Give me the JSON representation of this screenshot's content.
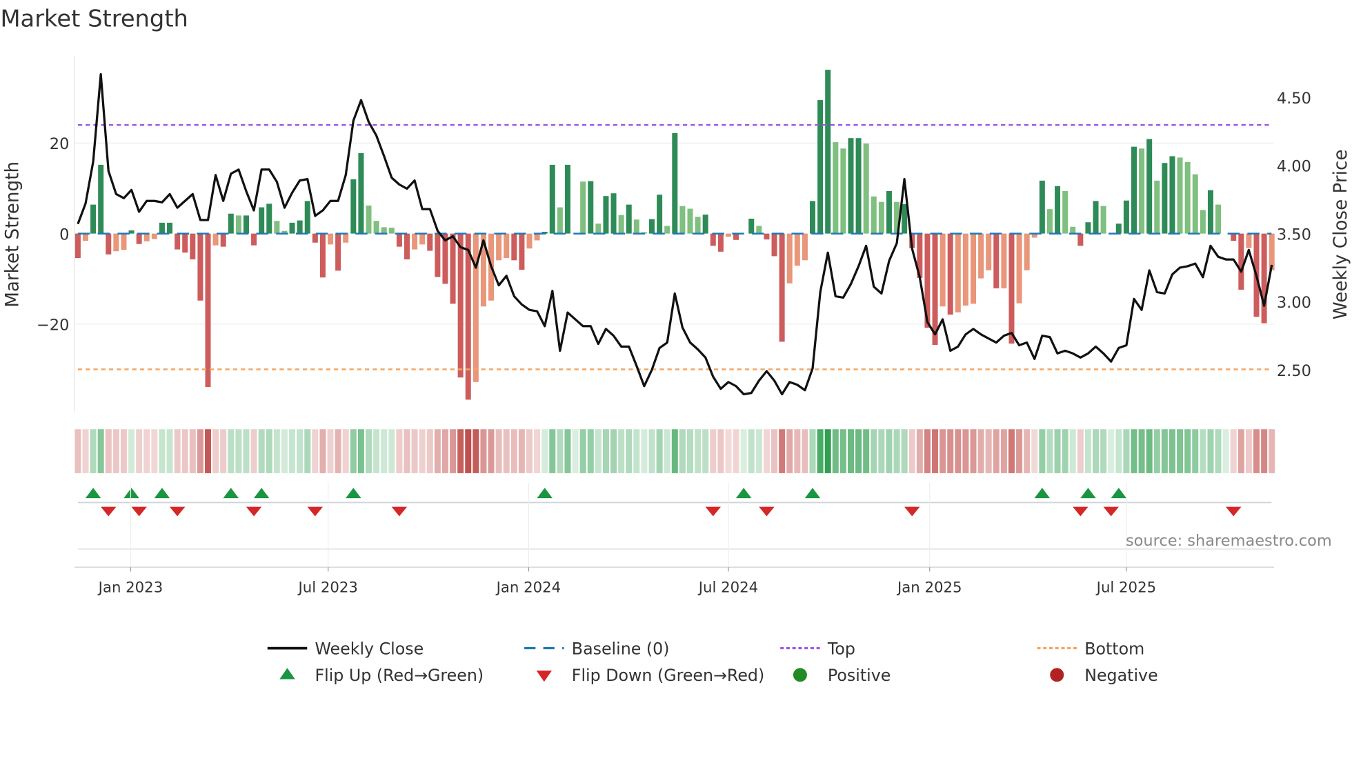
{
  "chart_data": {
    "type": "bar",
    "title": "Market Strength",
    "ylabel": "Market Strength",
    "y2label": "Weekly Close Price",
    "source": "source: sharemaestro.com",
    "ylim": [
      -40,
      40
    ],
    "y2lim": [
      2.2,
      4.8
    ],
    "y_ticks": [
      {
        "v": -20,
        "label": "−20"
      },
      {
        "v": 0,
        "label": "0"
      },
      {
        "v": 20,
        "label": "20"
      }
    ],
    "y2_ticks": [
      {
        "v": 2.5,
        "label": "2.50"
      },
      {
        "v": 3.0,
        "label": "3.00"
      },
      {
        "v": 3.5,
        "label": "3.50"
      },
      {
        "v": 4.0,
        "label": "4.00"
      },
      {
        "v": 4.5,
        "label": "4.50"
      }
    ],
    "x_ticks": [
      {
        "week": 6.9,
        "label": "Jan 2023"
      },
      {
        "week": 32.7,
        "label": "Jul 2023"
      },
      {
        "week": 58.9,
        "label": "Jan 2024"
      },
      {
        "week": 85.0,
        "label": "Jul 2024"
      },
      {
        "week": 111.3,
        "label": "Jan 2025"
      },
      {
        "week": 137.0,
        "label": "Jul 2025"
      }
    ],
    "top_level": 24,
    "bottom_level": -30,
    "baseline": 0,
    "strength": [
      -5.4,
      -1.6,
      6.4,
      15.2,
      -4.6,
      -3.9,
      -3.6,
      0.7,
      -2.3,
      -1.7,
      -1.2,
      2.4,
      2.4,
      -3.5,
      -4.2,
      -5.7,
      -14.8,
      -33.9,
      -2.6,
      -2.9,
      4.4,
      4.0,
      4.0,
      -2.6,
      5.8,
      6.6,
      2.8,
      0.6,
      2.4,
      2.9,
      7.2,
      -2.0,
      -9.7,
      -2.4,
      -8.2,
      -2.0,
      12.0,
      17.8,
      6.2,
      2.8,
      1.4,
      1.3,
      -2.9,
      -5.7,
      -3.5,
      -2.4,
      -3.8,
      -9.6,
      -11.1,
      -15.5,
      -31.8,
      -36.7,
      -32.8,
      -16.1,
      -14.8,
      -5.9,
      -5.4,
      -5.9,
      -8.0,
      -3.3,
      -1.5,
      0.4,
      15.2,
      5.8,
      15.2,
      0,
      11.5,
      11.6,
      2.2,
      8.3,
      8.9,
      4.1,
      6.4,
      3.1,
      0.3,
      3.2,
      8.6,
      1.7,
      22.2,
      6.1,
      5.5,
      3.7,
      4.2,
      -2.7,
      -4.0,
      -0.7,
      -1.4,
      0,
      3.3,
      1.7,
      -1.3,
      -5.0,
      -23.9,
      -11.0,
      -7.1,
      -5.9,
      7.2,
      29.5,
      36.2,
      20.2,
      18.8,
      21.1,
      21.1,
      19.9,
      8.2,
      7.0,
      9.4,
      7.0,
      6.5,
      -3.2,
      -9.8,
      -20.8,
      -24.6,
      -16.1,
      -17.9,
      -17.4,
      -15.9,
      -15.5,
      -9.9,
      -8.1,
      -12.1,
      -12.1,
      -24.3,
      -15.4,
      -8.1,
      -0.9,
      11.7,
      5.4,
      10.5,
      9.4,
      1.5,
      -2.7,
      2.5,
      7.2,
      6.1,
      0,
      2.2,
      7.3,
      19.2,
      18.8,
      20.9,
      11.7,
      15.6,
      17.1,
      16.8,
      15.8,
      13.1,
      5.2,
      9.6,
      6.4,
      0,
      -1.6,
      -12.4,
      -3.2,
      -18.4,
      -19.8,
      -8.1
    ],
    "strong": [
      1,
      0,
      1,
      1,
      1,
      0,
      0,
      1,
      1,
      0,
      0,
      1,
      1,
      1,
      1,
      1,
      1,
      1,
      0,
      1,
      1,
      0,
      1,
      1,
      1,
      1,
      0,
      0,
      1,
      1,
      1,
      1,
      1,
      0,
      1,
      0,
      1,
      1,
      0,
      0,
      0,
      0,
      1,
      1,
      0,
      0,
      1,
      1,
      1,
      1,
      1,
      1,
      0,
      0,
      0,
      0,
      0,
      1,
      1,
      0,
      0,
      1,
      1,
      0,
      1,
      0,
      0,
      1,
      0,
      1,
      1,
      0,
      1,
      0,
      0,
      1,
      1,
      0,
      1,
      0,
      0,
      0,
      1,
      1,
      1,
      0,
      1,
      0,
      1,
      0,
      1,
      1,
      1,
      0,
      0,
      0,
      1,
      1,
      1,
      0,
      0,
      1,
      1,
      0,
      0,
      0,
      1,
      0,
      1,
      1,
      1,
      1,
      1,
      0,
      1,
      0,
      0,
      0,
      0,
      0,
      1,
      0,
      1,
      0,
      0,
      0,
      1,
      0,
      1,
      0,
      0,
      1,
      1,
      1,
      0,
      0,
      1,
      1,
      1,
      0,
      1,
      0,
      1,
      1,
      0,
      0,
      0,
      0,
      1,
      0,
      0,
      1,
      1,
      0,
      1,
      1,
      0
    ],
    "weekly_close": [
      3.57,
      3.72,
      4.03,
      4.67,
      3.96,
      3.79,
      3.76,
      3.82,
      3.66,
      3.74,
      3.74,
      3.73,
      3.79,
      3.69,
      3.74,
      3.79,
      3.6,
      3.6,
      3.93,
      3.74,
      3.94,
      3.97,
      3.81,
      3.67,
      3.97,
      3.97,
      3.88,
      3.69,
      3.8,
      3.89,
      3.9,
      3.63,
      3.67,
      3.74,
      3.74,
      3.93,
      4.33,
      4.48,
      4.32,
      4.22,
      4.07,
      3.91,
      3.86,
      3.83,
      3.89,
      3.68,
      3.68,
      3.52,
      3.45,
      3.48,
      3.4,
      3.38,
      3.25,
      3.45,
      3.26,
      3.12,
      3.19,
      3.04,
      2.98,
      2.94,
      2.93,
      2.82,
      3.08,
      2.64,
      2.92,
      2.87,
      2.82,
      2.82,
      2.69,
      2.8,
      2.75,
      2.67,
      2.67,
      2.53,
      2.38,
      2.5,
      2.66,
      2.7,
      3.06,
      2.81,
      2.7,
      2.65,
      2.59,
      2.45,
      2.36,
      2.41,
      2.38,
      2.32,
      2.33,
      2.42,
      2.49,
      2.42,
      2.32,
      2.41,
      2.39,
      2.35,
      2.51,
      3.07,
      3.36,
      3.04,
      3.03,
      3.13,
      3.26,
      3.41,
      3.11,
      3.06,
      3.3,
      3.43,
      3.9,
      3.39,
      3.18,
      2.85,
      2.76,
      2.87,
      2.64,
      2.67,
      2.76,
      2.8,
      2.76,
      2.73,
      2.7,
      2.75,
      2.77,
      2.68,
      2.7,
      2.58,
      2.75,
      2.74,
      2.62,
      2.64,
      2.62,
      2.59,
      2.62,
      2.67,
      2.62,
      2.56,
      2.66,
      2.68,
      3.02,
      2.94,
      3.23,
      3.07,
      3.06,
      3.2,
      3.25,
      3.26,
      3.28,
      3.18,
      3.41,
      3.33,
      3.31,
      3.31,
      3.22,
      3.38,
      3.19,
      2.97,
      3.27
    ],
    "flip_up_weeks": [
      2,
      7,
      11,
      20,
      24,
      36,
      61,
      87,
      96,
      126,
      132,
      136
    ],
    "flip_down_weeks": [
      4,
      8,
      13,
      23,
      31,
      42,
      83,
      90,
      109,
      131,
      135,
      151
    ],
    "legend": [
      {
        "key": "close",
        "label": "Weekly Close"
      },
      {
        "key": "baseline",
        "label": "Baseline (0)"
      },
      {
        "key": "top",
        "label": "Top"
      },
      {
        "key": "bottom",
        "label": "Bottom"
      },
      {
        "key": "flip_up",
        "label": "Flip Up (Red→Green)"
      },
      {
        "key": "flip_down",
        "label": "Flip Down (Green→Red)"
      },
      {
        "key": "positive",
        "label": "Positive"
      },
      {
        "key": "negative",
        "label": "Negative"
      }
    ],
    "legend_placement": "bottom",
    "colors": {
      "pos_strong": "#2e8b57",
      "pos_weak": "#7fbf7f",
      "neg_strong": "#cd5c5c",
      "neg_weak": "#e9967a",
      "baseline": "#1f77b4",
      "top": "#9b59e0",
      "bottom": "#f4a460",
      "close": "#111111",
      "flip_up": "#1a9641",
      "flip_down": "#d62728",
      "positive": "#228b22",
      "negative": "#b22222",
      "strip_pos": "#2e9e4f",
      "strip_neg": "#c0504d"
    }
  }
}
